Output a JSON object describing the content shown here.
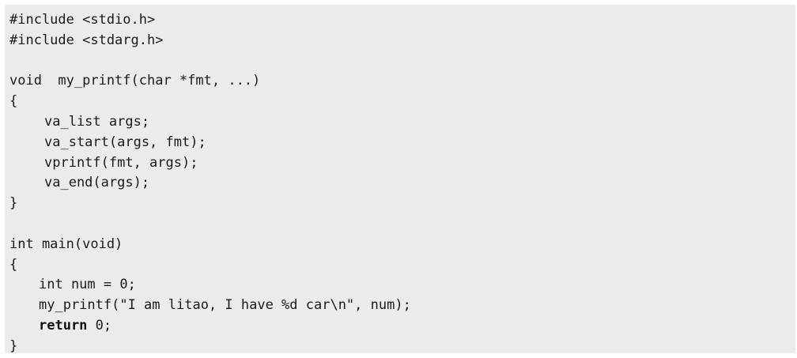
{
  "code": {
    "lines": [
      "#include <stdio.h>",
      "#include <stdarg.h>",
      "",
      "void  my_printf(char *fmt, ...)",
      "{",
      "va_list args;",
      "va_start(args, fmt);",
      "vprintf(fmt, args);",
      "va_end(args);",
      "}",
      "",
      "int main(void)",
      "{",
      "int num = 0;",
      "my_printf(\"I am litao, I have %d car\\n\", num);",
      "return",
      " 0;",
      "}"
    ]
  }
}
